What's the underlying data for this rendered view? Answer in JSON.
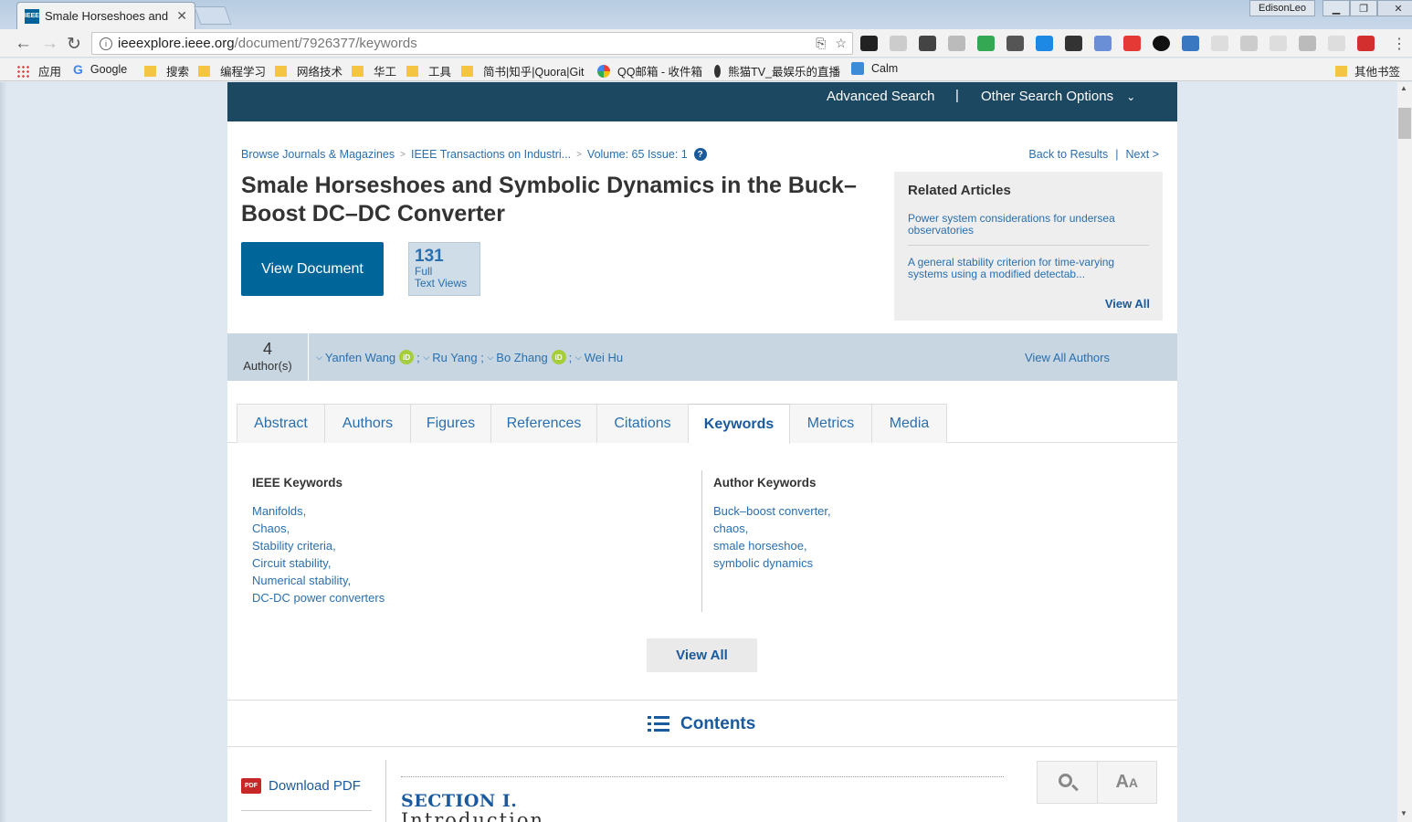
{
  "browser": {
    "tab_title": "Smale Horseshoes and",
    "tab_favicon_text": "IEEE",
    "user_name": "EdisonLeo",
    "url_host": "ieeexplore.ieee.org",
    "url_path": "/document/7926377/keywords",
    "bookmarks": {
      "apps": "应用",
      "google": "Google",
      "search": "搜索",
      "programming": "编程学习",
      "network": "网络技术",
      "huagong": "华工",
      "tools": "工具",
      "jianshu": "简书|知乎|Quora|Git",
      "qqmail": "QQ邮箱 - 收件箱",
      "pandatv": "熊猫TV_最娱乐的直播",
      "calm": "Calm",
      "other": "其他书签"
    }
  },
  "topnav": {
    "advanced_search": "Advanced Search",
    "separator": "|",
    "other_options": "Other Search Options"
  },
  "breadcrumb": {
    "browse": "Browse Journals & Magazines",
    "journal": "IEEE Transactions on Industri...",
    "volume": "Volume: 65 Issue: 1",
    "back": "Back to Results",
    "next": "Next >"
  },
  "article": {
    "title": "Smale Horseshoes and Symbolic Dynamics in the Buck–Boost DC–DC Converter",
    "view_document": "View Document",
    "full_text_views_count": "131",
    "full_text_views_label_1": "Full",
    "full_text_views_label_2": "Text Views"
  },
  "related": {
    "heading": "Related Articles",
    "articles": [
      "Power system considerations for undersea observatories",
      "A general stability criterion for time-varying systems using a modified detectab..."
    ],
    "view_all": "View All"
  },
  "authors": {
    "count": "4",
    "count_label": "Author(s)",
    "list": [
      "Yanfen Wang",
      "Ru Yang",
      "Bo Zhang",
      "Wei Hu"
    ],
    "view_all": "View All Authors"
  },
  "tabs": [
    "Abstract",
    "Authors",
    "Figures",
    "References",
    "Citations",
    "Keywords",
    "Metrics",
    "Media"
  ],
  "active_tab": "Keywords",
  "keywords": {
    "ieee_heading": "IEEE Keywords",
    "ieee": [
      "Manifolds,",
      "Chaos,",
      "Stability criteria,",
      "Circuit stability,",
      "Numerical stability,",
      "DC-DC power converters"
    ],
    "author_heading": "Author Keywords",
    "author": [
      "Buck–boost converter,",
      "chaos,",
      "smale horseshoe,",
      "symbolic dynamics"
    ],
    "view_all": "View All"
  },
  "contents": {
    "label": "Contents",
    "download_pdf": "Download PDF",
    "pdf_icon_text": "PDF",
    "section_label": "SECTION I.",
    "section_title": "Introduction"
  },
  "colors": {
    "nav_bg": "#1d4862",
    "primary_button": "#006699",
    "link": "#2a6fae",
    "author_bar": "#c7d6e1",
    "orcid": "#a6ce39"
  }
}
